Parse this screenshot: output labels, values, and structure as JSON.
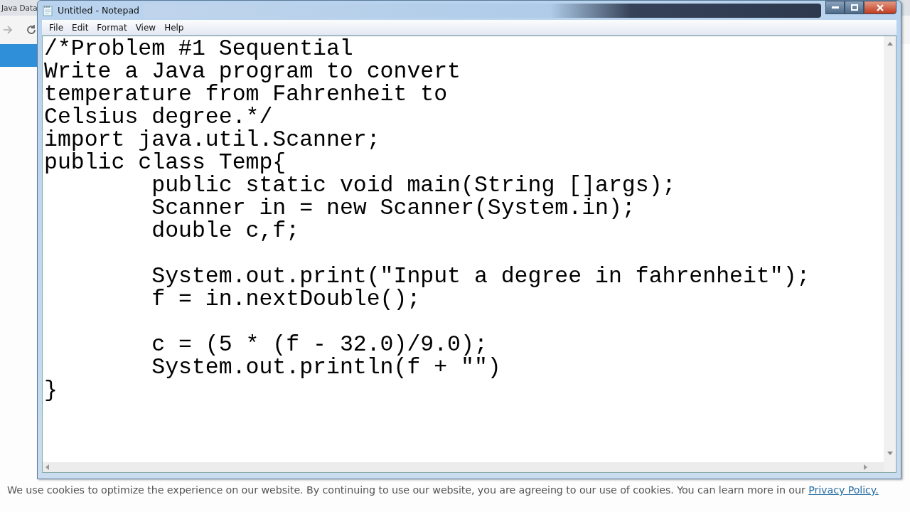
{
  "browser": {
    "tab_title": "Java Data",
    "cookie_notice": {
      "text": "We use cookies to optimize the experience on our website. By continuing to use our website, you are agreeing to our use of cookies. You can learn more in our",
      "link": "Privacy Policy."
    }
  },
  "window": {
    "title": "Untitled - Notepad"
  },
  "menu": [
    "File",
    "Edit",
    "Format",
    "View",
    "Help"
  ],
  "editor": {
    "content": "/*Problem #1 Sequential\nWrite a Java program to convert\ntemperature from Fahrenheit to\nCelsius degree.*/\nimport java.util.Scanner;\npublic class Temp{\n\tpublic static void main(String []args);\n\tScanner in = new Scanner(System.in);\n\tdouble c,f;\n\n\tSystem.out.print(\"Input a degree in fahrenheit\");\n\tf = in.nextDouble();\n\n\tc = (5 * (f - 32.0)/9.0);\n\tSystem.out.println(f + \"\")\n}"
  }
}
